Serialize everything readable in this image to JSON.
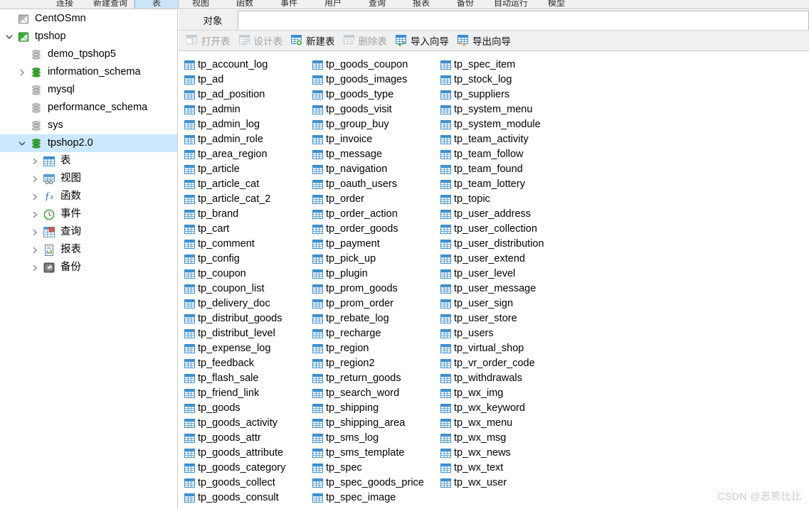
{
  "main_toolbar": {
    "items": [
      {
        "label": "连接",
        "active": false
      },
      {
        "label": "新建查询",
        "active": false
      },
      {
        "label": "表",
        "active": true
      },
      {
        "label": "视图",
        "active": false
      },
      {
        "label": "函数",
        "active": false
      },
      {
        "label": "事件",
        "active": false
      },
      {
        "label": "用户",
        "active": false
      },
      {
        "label": "查询",
        "active": false
      },
      {
        "label": "报表",
        "active": false
      },
      {
        "label": "备份",
        "active": false
      },
      {
        "label": "自动运行",
        "active": false
      },
      {
        "label": "模型",
        "active": false
      }
    ]
  },
  "sidebar": {
    "items": [
      {
        "label": "CentOSmn",
        "level": 0,
        "icon": "connection-gray",
        "twisty": "",
        "selected": false
      },
      {
        "label": "tpshop",
        "level": 0,
        "icon": "connection-green",
        "twisty": "expanded",
        "selected": false
      },
      {
        "label": "demo_tpshop5",
        "level": 1,
        "icon": "database-gray",
        "twisty": "",
        "selected": false
      },
      {
        "label": "information_schema",
        "level": 1,
        "icon": "database-green",
        "twisty": "collapsed",
        "selected": false
      },
      {
        "label": "mysql",
        "level": 1,
        "icon": "database-gray",
        "twisty": "",
        "selected": false
      },
      {
        "label": "performance_schema",
        "level": 1,
        "icon": "database-gray",
        "twisty": "",
        "selected": false
      },
      {
        "label": "sys",
        "level": 1,
        "icon": "database-gray",
        "twisty": "",
        "selected": false
      },
      {
        "label": "tpshop2.0",
        "level": 1,
        "icon": "database-green",
        "twisty": "expanded",
        "selected": true
      },
      {
        "label": "表",
        "level": 2,
        "icon": "table-icon",
        "twisty": "collapsed",
        "selected": false
      },
      {
        "label": "视图",
        "level": 2,
        "icon": "view-icon",
        "twisty": "collapsed",
        "selected": false
      },
      {
        "label": "函数",
        "level": 2,
        "icon": "function-icon",
        "twisty": "collapsed",
        "selected": false
      },
      {
        "label": "事件",
        "level": 2,
        "icon": "event-icon",
        "twisty": "collapsed",
        "selected": false
      },
      {
        "label": "查询",
        "level": 2,
        "icon": "query-icon",
        "twisty": "collapsed",
        "selected": false
      },
      {
        "label": "报表",
        "level": 2,
        "icon": "report-icon",
        "twisty": "collapsed",
        "selected": false
      },
      {
        "label": "备份",
        "level": 2,
        "icon": "backup-icon",
        "twisty": "collapsed",
        "selected": false
      }
    ]
  },
  "tabs": [
    {
      "label": "对象",
      "active": true
    }
  ],
  "search": {
    "value": "",
    "placeholder": ""
  },
  "object_toolbar": {
    "buttons": [
      {
        "label": "打开表",
        "icon": "open-table-icon",
        "disabled": true
      },
      {
        "label": "设计表",
        "icon": "design-table-icon",
        "disabled": true
      },
      {
        "label": "新建表",
        "icon": "new-table-icon",
        "disabled": false
      },
      {
        "label": "删除表",
        "icon": "delete-table-icon",
        "disabled": true
      },
      {
        "label": "导入向导",
        "icon": "import-wizard-icon",
        "disabled": false
      },
      {
        "label": "导出向导",
        "icon": "export-wizard-icon",
        "disabled": false
      }
    ]
  },
  "object_list": {
    "icon": "table-grid-icon",
    "tables": [
      "tp_account_log",
      "tp_ad",
      "tp_ad_position",
      "tp_admin",
      "tp_admin_log",
      "tp_admin_role",
      "tp_area_region",
      "tp_article",
      "tp_article_cat",
      "tp_article_cat_2",
      "tp_brand",
      "tp_cart",
      "tp_comment",
      "tp_config",
      "tp_coupon",
      "tp_coupon_list",
      "tp_delivery_doc",
      "tp_distribut_goods",
      "tp_distribut_level",
      "tp_expense_log",
      "tp_feedback",
      "tp_flash_sale",
      "tp_friend_link",
      "tp_goods",
      "tp_goods_activity",
      "tp_goods_attr",
      "tp_goods_attribute",
      "tp_goods_category",
      "tp_goods_collect",
      "tp_goods_consult",
      "tp_goods_coupon",
      "tp_goods_images",
      "tp_goods_type",
      "tp_goods_visit",
      "tp_group_buy",
      "tp_invoice",
      "tp_message",
      "tp_navigation",
      "tp_oauth_users",
      "tp_order",
      "tp_order_action",
      "tp_order_goods",
      "tp_payment",
      "tp_pick_up",
      "tp_plugin",
      "tp_prom_goods",
      "tp_prom_order",
      "tp_rebate_log",
      "tp_recharge",
      "tp_region",
      "tp_region2",
      "tp_return_goods",
      "tp_search_word",
      "tp_shipping",
      "tp_shipping_area",
      "tp_sms_log",
      "tp_sms_template",
      "tp_spec",
      "tp_spec_goods_price",
      "tp_spec_image",
      "tp_spec_item",
      "tp_stock_log",
      "tp_suppliers",
      "tp_system_menu",
      "tp_system_module",
      "tp_team_activity",
      "tp_team_follow",
      "tp_team_found",
      "tp_team_lottery",
      "tp_topic",
      "tp_user_address",
      "tp_user_collection",
      "tp_user_distribution",
      "tp_user_extend",
      "tp_user_level",
      "tp_user_message",
      "tp_user_sign",
      "tp_user_store",
      "tp_users",
      "tp_virtual_shop",
      "tp_vr_order_code",
      "tp_withdrawals",
      "tp_wx_img",
      "tp_wx_keyword",
      "tp_wx_menu",
      "tp_wx_msg",
      "tp_wx_news",
      "tp_wx_text",
      "tp_wx_user"
    ]
  },
  "watermark": {
    "text": "CSDN @恶熊比比"
  },
  "colors": {
    "accent_blue": "#3d8fd1",
    "selection_blue": "#cce8ff",
    "toolbar_gray": "#f0f0f0",
    "database_green": "#1fa81f",
    "database_gray": "#9a9a9a",
    "disabled_text": "#a3a3a3"
  }
}
